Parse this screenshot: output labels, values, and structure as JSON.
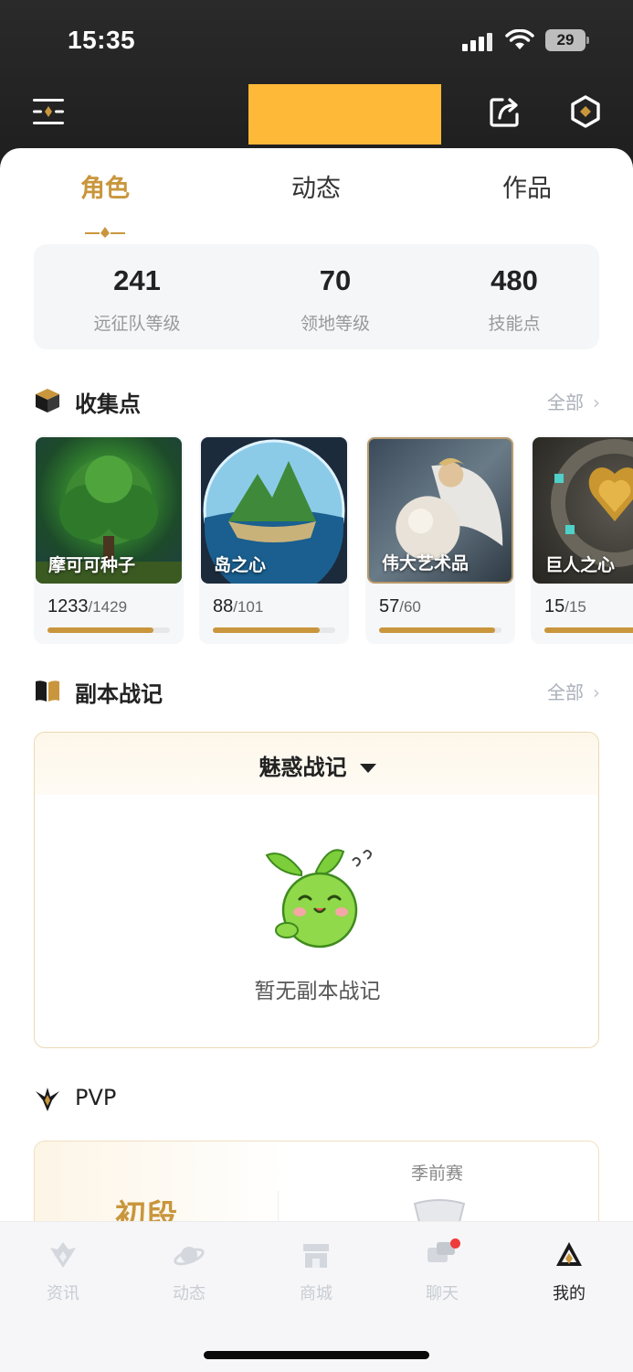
{
  "status_bar": {
    "time": "15:35",
    "battery": "29"
  },
  "header": {
    "menu_icon": "menu-lines-icon",
    "share_icon": "share-icon",
    "settings_icon": "hexagon-settings-icon"
  },
  "tabs": [
    {
      "label": "角色",
      "active": true
    },
    {
      "label": "动态",
      "active": false
    },
    {
      "label": "作品",
      "active": false
    }
  ],
  "stats": [
    {
      "value": "241",
      "label": "远征队等级"
    },
    {
      "value": "70",
      "label": "领地等级"
    },
    {
      "value": "480",
      "label": "技能点"
    }
  ],
  "collection": {
    "title": "收集点",
    "more_label": "全部",
    "items": [
      {
        "name": "摩可可种子",
        "current": "1233",
        "total": "/1429",
        "fraction": 0.863
      },
      {
        "name": "岛之心",
        "current": "88",
        "total": "/101",
        "fraction": 0.871
      },
      {
        "name": "伟大艺术品",
        "current": "57",
        "total": "/60",
        "fraction": 0.95
      },
      {
        "name": "巨人之心",
        "current": "15",
        "total": "/15",
        "fraction": 1.0
      }
    ]
  },
  "dungeon": {
    "title": "副本战记",
    "more_label": "全部",
    "selected": "魅惑战记",
    "empty_text": "暂无副本战记"
  },
  "pvp": {
    "title": "PVP",
    "rank": "初段",
    "season": "季前赛"
  },
  "bottom_nav": [
    {
      "label": "资讯",
      "icon": "news-icon",
      "active": false
    },
    {
      "label": "动态",
      "icon": "planet-icon",
      "active": false
    },
    {
      "label": "商城",
      "icon": "shop-icon",
      "active": false
    },
    {
      "label": "聊天",
      "icon": "chat-icon",
      "active": false,
      "badge": true
    },
    {
      "label": "我的",
      "icon": "profile-icon",
      "active": true
    }
  ],
  "colors": {
    "accent": "#c9963d",
    "header_block": "#ffb938",
    "badge": "#ee3b3b"
  }
}
